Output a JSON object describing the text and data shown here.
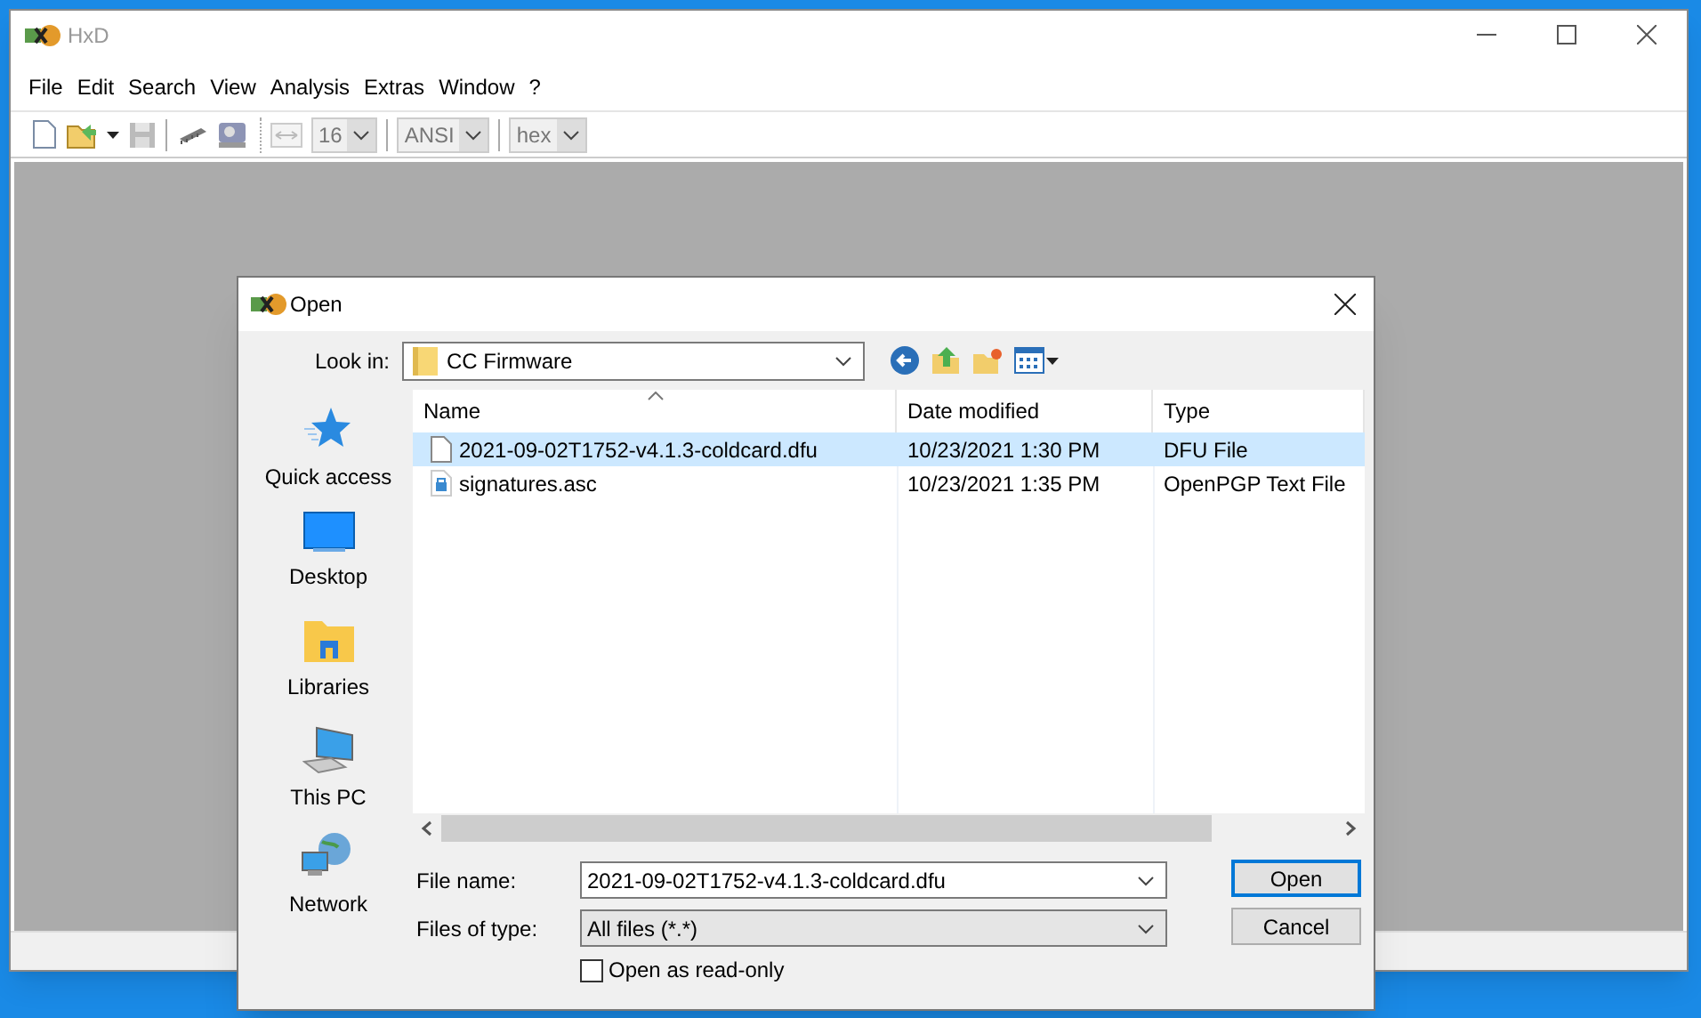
{
  "app": {
    "title": "HxD",
    "menu": [
      "File",
      "Edit",
      "Search",
      "View",
      "Analysis",
      "Extras",
      "Window",
      "?"
    ],
    "toolbar": {
      "bytes_per_row": "16",
      "charset": "ANSI",
      "offset_base": "hex"
    }
  },
  "dialog": {
    "title": "Open",
    "look_in_label": "Look in:",
    "look_in": "CC Firmware",
    "places": [
      {
        "label": "Quick access",
        "kind": "star"
      },
      {
        "label": "Desktop",
        "kind": "desktop"
      },
      {
        "label": "Libraries",
        "kind": "libraries"
      },
      {
        "label": "This PC",
        "kind": "pc"
      },
      {
        "label": "Network",
        "kind": "network"
      }
    ],
    "columns": [
      "Name",
      "Date modified",
      "Type"
    ],
    "files": [
      {
        "name": "2021-09-02T1752-v4.1.3-coldcard.dfu",
        "date": "10/23/2021 1:30 PM",
        "type": "DFU File",
        "kind": "document",
        "selected": true
      },
      {
        "name": "signatures.asc",
        "date": "10/23/2021 1:35 PM",
        "type": "OpenPGP Text File",
        "kind": "signed",
        "selected": false
      }
    ],
    "file_name_label": "File name:",
    "file_name": "2021-09-02T1752-v4.1.3-coldcard.dfu",
    "file_type_label": "Files of type:",
    "file_type": "All files (*.*)",
    "read_only": {
      "label": "Open as read-only",
      "checked": false
    },
    "buttons": [
      {
        "label": "Open",
        "default": true
      },
      {
        "label": "Cancel",
        "default": false
      }
    ]
  }
}
